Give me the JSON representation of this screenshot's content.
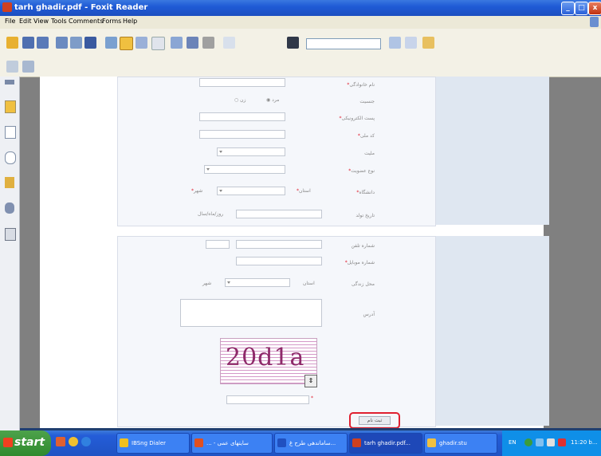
{
  "window": {
    "title": "tarh ghadir.pdf - Foxit Reader"
  },
  "menu": [
    "File",
    "Edit",
    "View",
    "Tools",
    "Comments",
    "Forms",
    "Help"
  ],
  "form": {
    "section1": [
      {
        "label": "نام خانوادگی",
        "required": true
      },
      {
        "label": "جنسیت",
        "required": false,
        "options": [
          "مرد",
          "زن"
        ]
      },
      {
        "label": "پست الکترونیکی",
        "required": true
      },
      {
        "label": "کد ملی",
        "required": true
      },
      {
        "label": "ملیت",
        "required": false
      },
      {
        "label": "نوع عضویت",
        "required": true
      },
      {
        "label": "دانشگاه",
        "required": true,
        "sub1": "استان",
        "sub2": "شهر"
      },
      {
        "label": "تاریخ تولد",
        "required": false,
        "placeholder": "روز/ماه/سال"
      }
    ],
    "section2": [
      {
        "label": "شماره تلفن",
        "required": false
      },
      {
        "label": "شماره موبایل",
        "required": true
      },
      {
        "label": "محل زندگی",
        "required": false,
        "sub1": "استان",
        "sub2": "شهر"
      },
      {
        "label": "آدرس",
        "required": false
      }
    ],
    "captcha_text": "20d1a",
    "submit_label": "ثبت نام"
  },
  "taskbar": {
    "start_label": "start",
    "tasks": [
      "IBSng Dialer",
      "... - سایتهای عمی",
      "ساماندهی طرح غ...",
      "tarh ghadir.pdf...",
      "ghadir.stu"
    ],
    "lang": "EN",
    "time": "11:20 b..."
  }
}
